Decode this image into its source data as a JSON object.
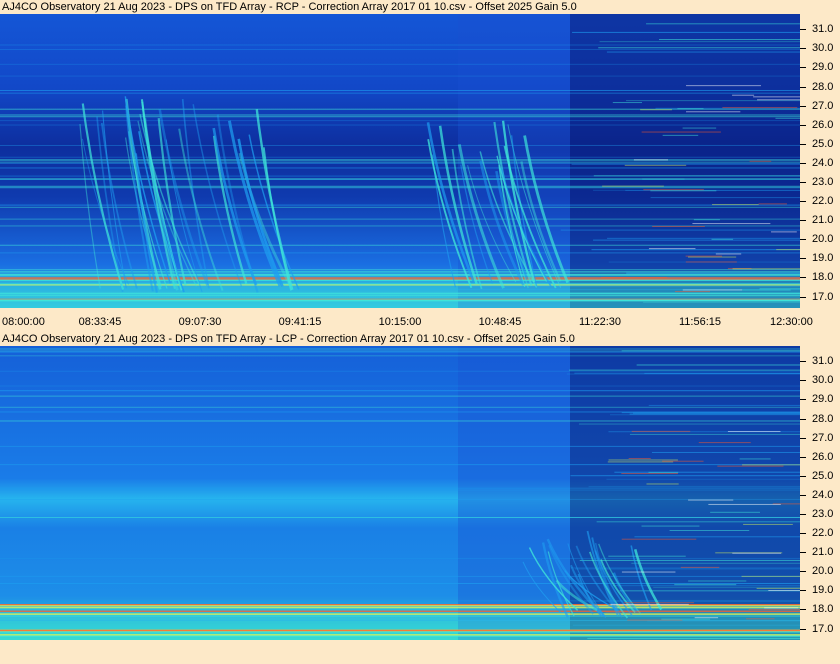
{
  "panels": [
    {
      "title": "AJ4CO Observatory 21 Aug 2023  -  DPS on TFD Array  -  RCP  -  Correction Array 2017 01 10.csv  -  Offset 2025  Gain 5.0",
      "polarization": "RCP"
    },
    {
      "title": "AJ4CO Observatory 21 Aug 2023  -  DPS on TFD Array  -  LCP  -  Correction Array 2017 01 10.csv  -  Offset 2025  Gain 5.0",
      "polarization": "LCP"
    }
  ],
  "x_tick_labels": [
    "08:00:00",
    "08:33:45",
    "09:07:30",
    "09:41:15",
    "10:15:00",
    "10:48:45",
    "11:22:30",
    "11:56:15",
    "12:30:00"
  ],
  "y_tick_labels": [
    "17.0",
    "18.0",
    "19.0",
    "20.0",
    "21.0",
    "22.0",
    "23.0",
    "24.0",
    "25.0",
    "26.0",
    "27.0",
    "28.0",
    "29.0",
    "30.0",
    "31.0"
  ],
  "chart_data": [
    {
      "type": "heatmap",
      "title": "AJ4CO Observatory 21 Aug 2023  -  DPS on TFD Array  -  RCP  -  Correction Array 2017 01 10.csv  -  Offset 2025  Gain 5.0",
      "xlabel": "",
      "ylabel": "",
      "x_ticks": [
        "08:00:00",
        "08:33:45",
        "09:07:30",
        "09:41:15",
        "10:15:00",
        "10:48:45",
        "11:22:30",
        "11:56:15",
        "12:30:00"
      ],
      "y_ticks": [
        17.0,
        18.0,
        19.0,
        20.0,
        21.0,
        22.0,
        23.0,
        24.0,
        25.0,
        26.0,
        27.0,
        28.0,
        29.0,
        30.0,
        31.0
      ],
      "ylim": [
        16.4,
        31.8
      ],
      "colormap": [
        "#0a1f8a",
        "#1550d8",
        "#1e9ef0",
        "#3fe6d9",
        "#d6f25a",
        "#ff5a2a"
      ]
    },
    {
      "type": "heatmap",
      "title": "AJ4CO Observatory 21 Aug 2023  -  DPS on TFD Array  -  LCP  -  Correction Array 2017 01 10.csv  -  Offset 2025  Gain 5.0",
      "xlabel": "",
      "ylabel": "",
      "x_ticks": [],
      "y_ticks": [
        17.0,
        18.0,
        19.0,
        20.0,
        21.0,
        22.0,
        23.0,
        24.0,
        25.0,
        26.0,
        27.0,
        28.0,
        29.0,
        30.0,
        31.0
      ],
      "ylim": [
        16.4,
        31.8
      ],
      "colormap": [
        "#0a1f8a",
        "#1550d8",
        "#1e9ef0",
        "#3fe6d9",
        "#d6f25a",
        "#ff5a2a"
      ]
    }
  ]
}
